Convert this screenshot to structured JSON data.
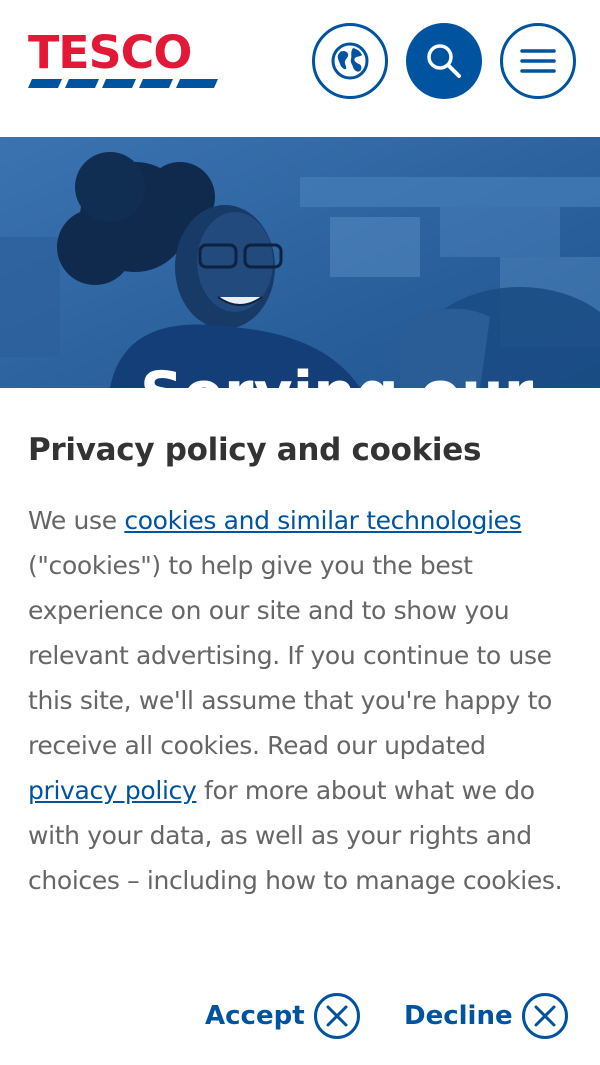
{
  "header": {
    "logo_text": "TESCO",
    "buttons": {
      "globe": "globe-icon",
      "search": "search-icon",
      "menu": "hamburger-menu-icon"
    }
  },
  "hero": {
    "title": "Serving our"
  },
  "cookie_banner": {
    "title": "Privacy policy and cookies",
    "body_before_link1": "We use ",
    "link1": "cookies and similar technologies ",
    "body_after_link1": "(\"cookies\") to help give you the best experience on our site and to show you relevant advertising. If you continue to use this site, we'll assume that you're happy to receive all cookies. Read our updated ",
    "link2": "privacy policy",
    "body_after_link2": " for more about what we do with your data, as well as your rights and choices – including how to manage cookies.",
    "accept_label": "Accept",
    "decline_label": "Decline"
  },
  "colors": {
    "brand_blue": "#00539f",
    "brand_red": "#e31836",
    "body_text": "#666666",
    "heading_text": "#333333"
  }
}
